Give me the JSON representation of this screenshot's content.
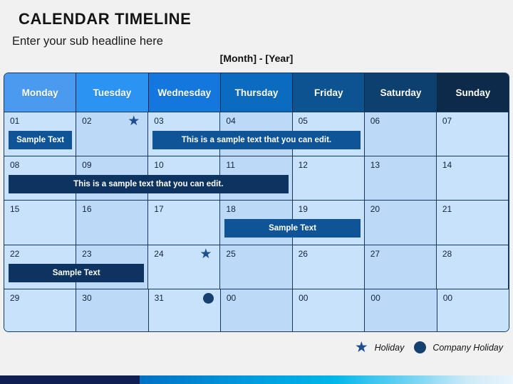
{
  "header": {
    "title": "CALENDAR TIMELINE",
    "subtitle": "Enter your sub headline here",
    "period": "[Month] - [Year]"
  },
  "weekdays": [
    {
      "label": "Monday",
      "color": "#4a9bf0"
    },
    {
      "label": "Tuesday",
      "color": "#2b93f2"
    },
    {
      "label": "Wednesday",
      "color": "#1377dd"
    },
    {
      "label": "Thursday",
      "color": "#0b6cbf"
    },
    {
      "label": "Friday",
      "color": "#0c5391"
    },
    {
      "label": "Saturday",
      "color": "#0d406f"
    },
    {
      "label": "Sunday",
      "color": "#0d2a4a"
    }
  ],
  "weeks": [
    {
      "days": [
        {
          "number": "01",
          "marker": ""
        },
        {
          "number": "02",
          "marker": "star"
        },
        {
          "number": "03",
          "marker": ""
        },
        {
          "number": "04",
          "marker": ""
        },
        {
          "number": "05",
          "marker": ""
        },
        {
          "number": "06",
          "marker": ""
        },
        {
          "number": "07",
          "marker": ""
        }
      ],
      "bars": [
        {
          "text": "Sample Text",
          "start": 0,
          "span": 1,
          "style": "bar-mid"
        },
        {
          "text": "This is a sample text that you can edit.",
          "start": 2,
          "span": 3,
          "style": "bar-mid"
        }
      ]
    },
    {
      "days": [
        {
          "number": "08",
          "marker": ""
        },
        {
          "number": "09",
          "marker": ""
        },
        {
          "number": "10",
          "marker": ""
        },
        {
          "number": "11",
          "marker": ""
        },
        {
          "number": "12",
          "marker": ""
        },
        {
          "number": "13",
          "marker": ""
        },
        {
          "number": "14",
          "marker": ""
        }
      ],
      "bars": [
        {
          "text": "This is a sample text that you can edit.",
          "start": 0,
          "span": 4,
          "style": "bar-dark"
        }
      ]
    },
    {
      "days": [
        {
          "number": "15",
          "marker": ""
        },
        {
          "number": "16",
          "marker": ""
        },
        {
          "number": "17",
          "marker": ""
        },
        {
          "number": "18",
          "marker": ""
        },
        {
          "number": "19",
          "marker": ""
        },
        {
          "number": "20",
          "marker": ""
        },
        {
          "number": "21",
          "marker": ""
        }
      ],
      "bars": [
        {
          "text": "Sample Text",
          "start": 3,
          "span": 2,
          "style": "bar-mid"
        }
      ]
    },
    {
      "days": [
        {
          "number": "22",
          "marker": ""
        },
        {
          "number": "23",
          "marker": ""
        },
        {
          "number": "24",
          "marker": "star"
        },
        {
          "number": "25",
          "marker": ""
        },
        {
          "number": "26",
          "marker": ""
        },
        {
          "number": "27",
          "marker": ""
        },
        {
          "number": "28",
          "marker": ""
        }
      ],
      "bars": [
        {
          "text": "Sample Text",
          "start": 0,
          "span": 2,
          "style": "bar-dark"
        }
      ]
    },
    {
      "days": [
        {
          "number": "29",
          "marker": ""
        },
        {
          "number": "30",
          "marker": ""
        },
        {
          "number": "31",
          "marker": "circle"
        },
        {
          "number": "00",
          "marker": ""
        },
        {
          "number": "00",
          "marker": ""
        },
        {
          "number": "00",
          "marker": ""
        },
        {
          "number": "00",
          "marker": ""
        }
      ],
      "bars": []
    }
  ],
  "legend": [
    {
      "icon": "star-icon",
      "glyph": "★",
      "label": "Holiday"
    },
    {
      "icon": "circle-icon",
      "glyph": "",
      "label": "Company Holiday"
    }
  ],
  "colors": {
    "accent_light": "#4a9bf0",
    "accent_dark": "#0d2a4a",
    "bar_mid": "#0e5496",
    "bar_dark": "#0d3460",
    "cell_bg": "#c3dffb",
    "marker": "#16406f"
  }
}
